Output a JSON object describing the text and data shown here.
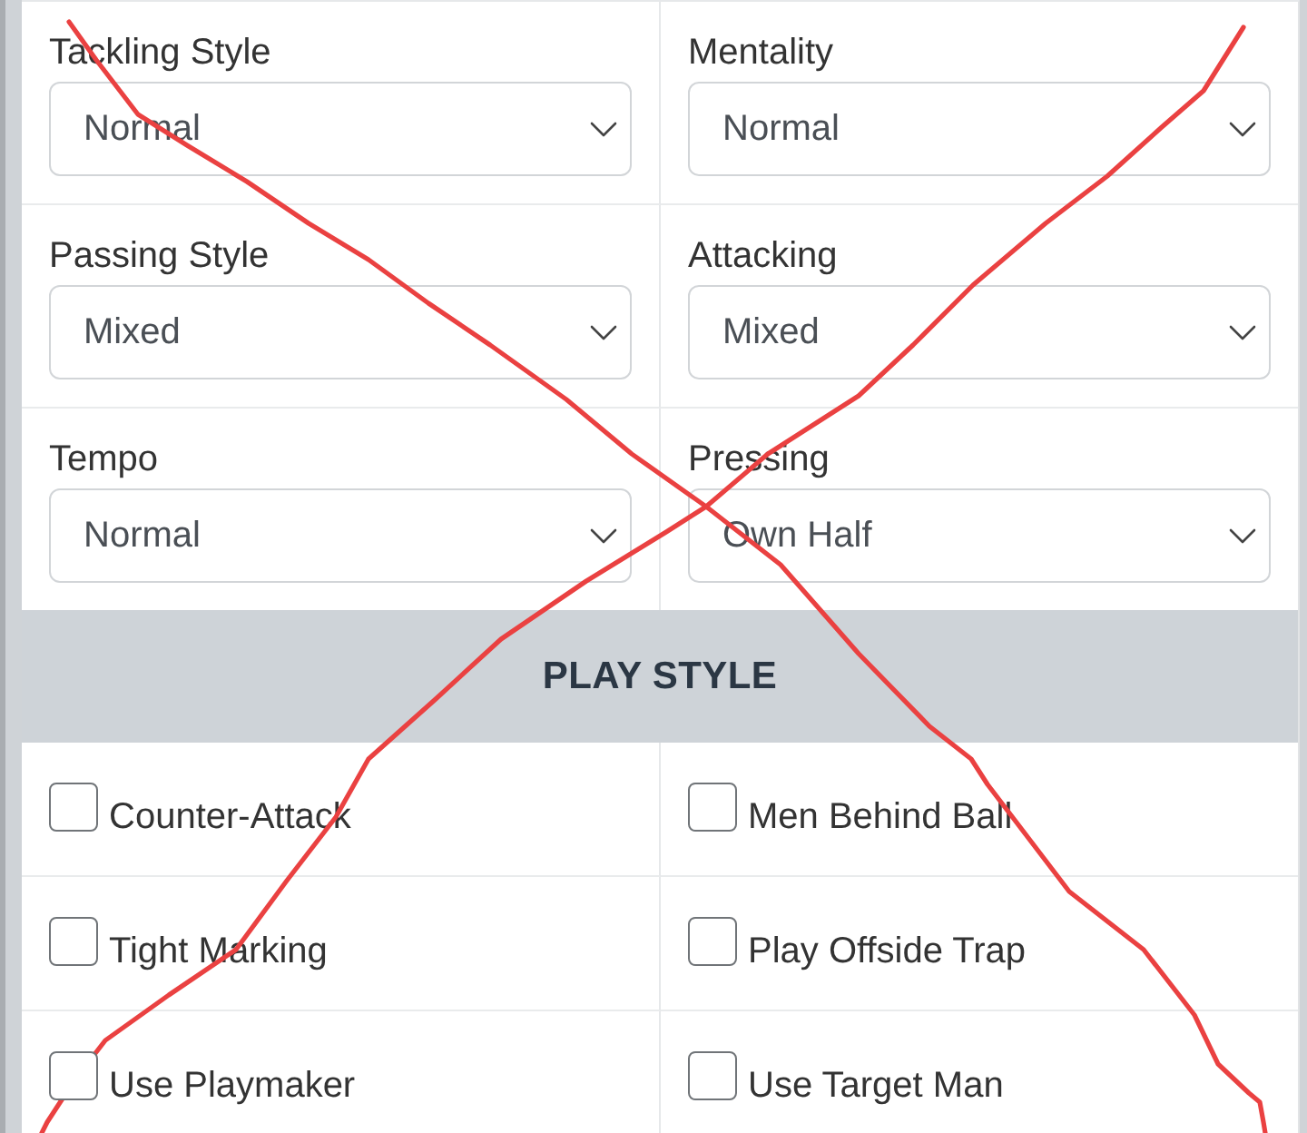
{
  "tactics": {
    "fields": [
      {
        "label": "Tackling Style",
        "value": "Normal"
      },
      {
        "label": "Mentality",
        "value": "Normal"
      },
      {
        "label": "Passing Style",
        "value": "Mixed"
      },
      {
        "label": "Attacking",
        "value": "Mixed"
      },
      {
        "label": "Tempo",
        "value": "Normal"
      },
      {
        "label": "Pressing",
        "value": "Own Half"
      }
    ]
  },
  "play_style": {
    "title": "PLAY STYLE",
    "options": [
      {
        "label": "Counter-Attack",
        "checked": false
      },
      {
        "label": "Men Behind Ball",
        "checked": false
      },
      {
        "label": "Tight Marking",
        "checked": false
      },
      {
        "label": "Play Offside Trap",
        "checked": false
      },
      {
        "label": "Use Playmaker",
        "checked": false
      },
      {
        "label": "Use Target Man",
        "checked": false
      }
    ]
  },
  "annotation": {
    "kind": "cross"
  }
}
